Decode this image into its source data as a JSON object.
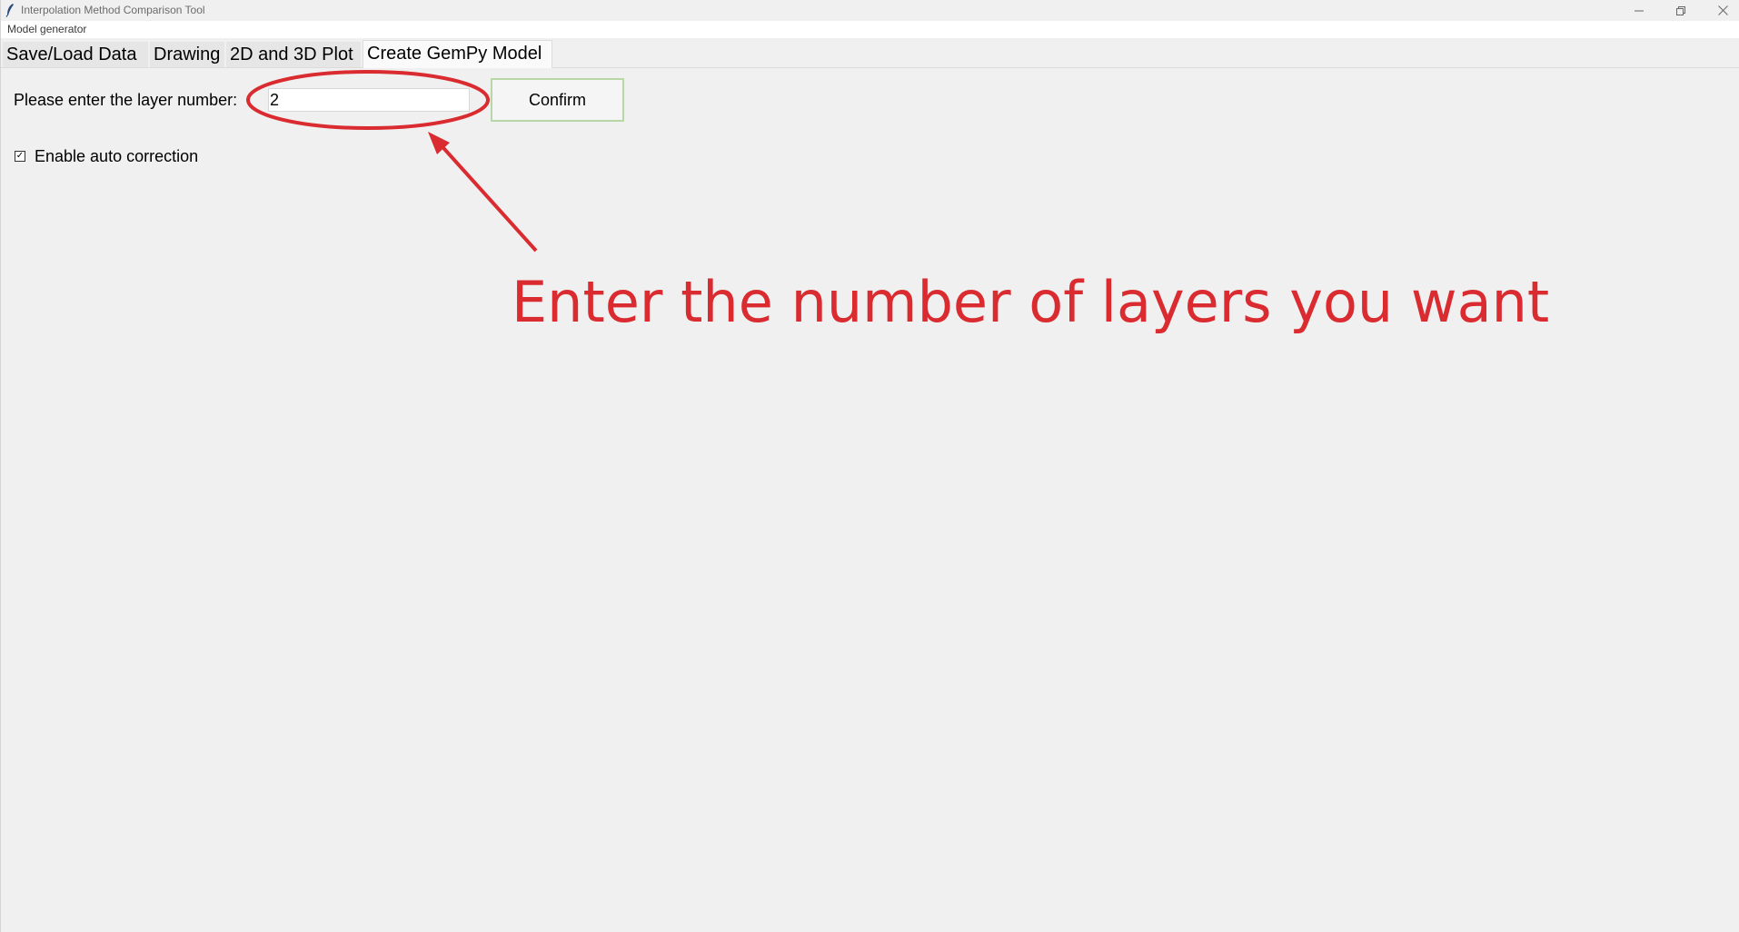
{
  "window": {
    "title": "Interpolation Method Comparison Tool",
    "icon": "feather-icon",
    "controls": [
      "minimize-icon",
      "restore-icon",
      "close-icon"
    ]
  },
  "menubar": {
    "items": [
      "Model generator"
    ]
  },
  "tabs": [
    {
      "label": "Save/Load Data",
      "active": false
    },
    {
      "label": "Drawing",
      "active": false
    },
    {
      "label": "2D and 3D Plot",
      "active": false
    },
    {
      "label": "Create GemPy Model",
      "active": true
    }
  ],
  "form": {
    "layer_label": "Please enter the layer number:",
    "layer_value": "2",
    "confirm_label": "Confirm",
    "auto_correction_label": "Enable auto correction",
    "auto_correction_checked": true,
    "checkmark": "✓"
  },
  "annotation": {
    "text": "Enter the number of layers you want",
    "color": "#d92b30"
  }
}
